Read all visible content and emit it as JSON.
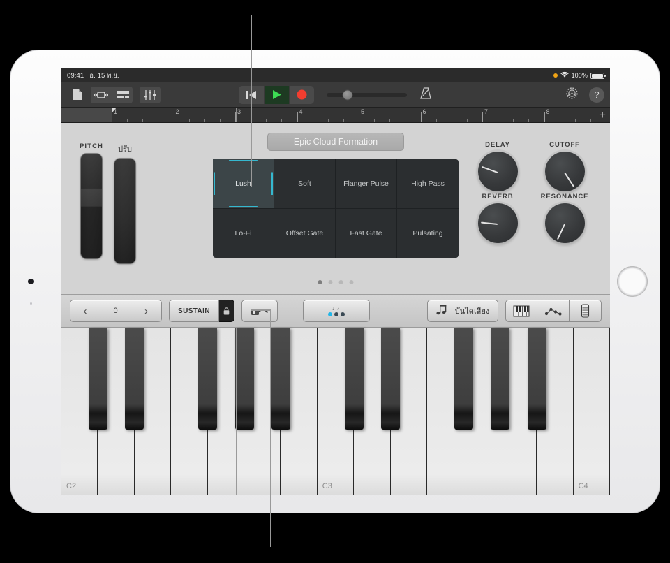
{
  "status_bar": {
    "time": "09:41",
    "date": "อ. 15 พ.ย.",
    "battery": "100%",
    "orange_dot_icon": "recording-indicator-dot",
    "wifi_icon": "wifi-icon",
    "battery_icon": "battery-full-icon"
  },
  "toolbar": {
    "browser_icon": "document-icon",
    "loops_icon": "loop-browser-icon",
    "tracks_icon": "track-view-icon",
    "mixer_icon": "mixer-faders-icon",
    "rewind_icon": "rewind-to-start-icon",
    "play_icon": "play-icon",
    "record_icon": "record-icon",
    "metronome_icon": "metronome-icon",
    "settings_icon": "gear-icon",
    "help_label": "?",
    "master_volume_value": "26"
  },
  "ruler": {
    "bars": [
      "1",
      "2",
      "3",
      "4",
      "5",
      "6",
      "7",
      "8"
    ],
    "playhead_bar": "1",
    "add_label": "+"
  },
  "instrument": {
    "preset_name": "Epic Cloud Formation",
    "wheels": [
      {
        "label": "PITCH",
        "name": "pitch-wheel"
      },
      {
        "label": "ปรับ",
        "name": "modulation-wheel"
      }
    ],
    "pads": [
      {
        "label": "Lush",
        "selected": true
      },
      {
        "label": "Soft",
        "selected": false
      },
      {
        "label": "Flanger Pulse",
        "selected": false
      },
      {
        "label": "High Pass",
        "selected": false
      },
      {
        "label": "Lo-Fi",
        "selected": false
      },
      {
        "label": "Offset Gate",
        "selected": false
      },
      {
        "label": "Fast Gate",
        "selected": false
      },
      {
        "label": "Pulsating",
        "selected": false
      }
    ],
    "page_dots": {
      "count": 4,
      "active_index": 0
    },
    "knobs": [
      {
        "label": "DELAY",
        "angle": -160
      },
      {
        "label": "CUTOFF",
        "angle": 57
      },
      {
        "label": "REVERB",
        "angle": 186
      },
      {
        "label": "RESONANCE",
        "angle": 115
      }
    ],
    "selection_color": "#35b8cf"
  },
  "control_strip": {
    "octave_prev": "‹",
    "octave_value": "0",
    "octave_next": "›",
    "sustain_label": "SUSTAIN",
    "sustain_lock_icon": "lock-icon",
    "glissando_icon": "glissando-scroll-icon",
    "arpeggiator_icon": "arpeggiator-icon",
    "scale_label": "บันไดเสียง",
    "scale_icon": "double-note-icon",
    "keyboard_view_icon": "keyboard-keys-icon",
    "notes_view_icon": "note-dots-icon",
    "strip_view_icon": "fretboard-strip-icon"
  },
  "keyboard": {
    "octave_labels": [
      "C2",
      "C3",
      "C4"
    ],
    "white_key_count": 15,
    "black_key_count": 10
  }
}
